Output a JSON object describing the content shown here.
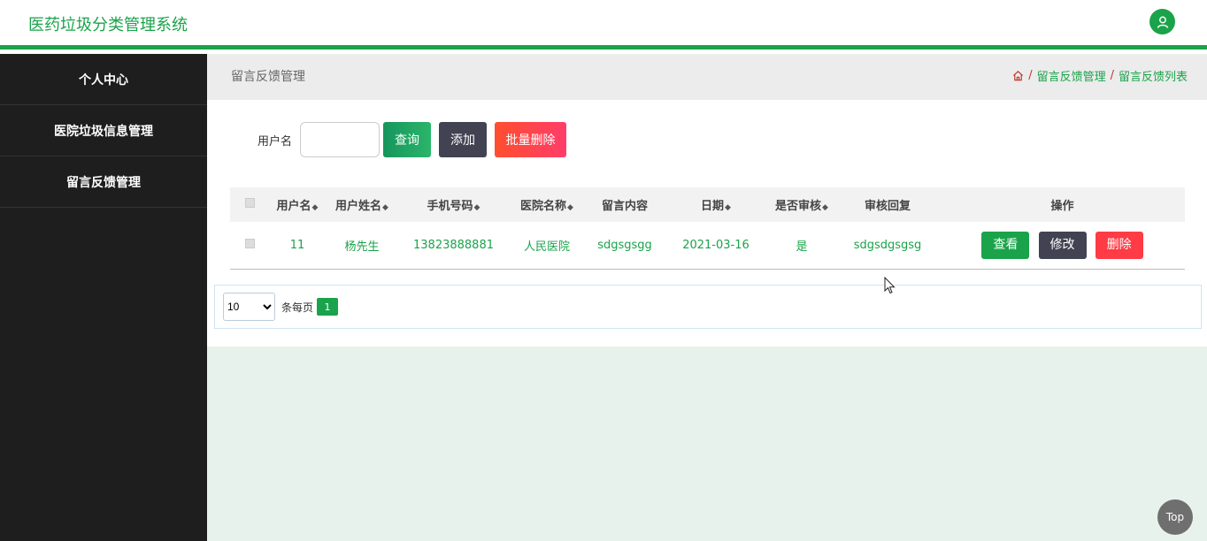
{
  "app": {
    "title": "医药垃圾分类管理系统"
  },
  "sidebar": {
    "items": [
      {
        "label": "个人中心"
      },
      {
        "label": "医院垃圾信息管理"
      },
      {
        "label": "留言反馈管理"
      }
    ]
  },
  "page": {
    "title": "留言反馈管理"
  },
  "breadcrumb": {
    "sep": "/",
    "items": [
      "留言反馈管理",
      "留言反馈列表"
    ]
  },
  "search": {
    "label": "用户名",
    "value": "",
    "query_label": "查询",
    "add_label": "添加",
    "bulk_delete_label": "批量删除"
  },
  "table": {
    "headers": [
      "用户名",
      "用户姓名",
      "手机号码",
      "医院名称",
      "留言内容",
      "日期",
      "是否审核",
      "审核回复",
      "操作"
    ],
    "rows": [
      {
        "username": "11",
        "name": "杨先生",
        "phone": "13823888881",
        "hospital": "人民医院",
        "content": "sdgsgsgg",
        "date": "2021-03-16",
        "reviewed": "是",
        "reply": "sdgsdgsgsg"
      }
    ],
    "actions": {
      "view": "查看",
      "edit": "修改",
      "delete": "删除"
    }
  },
  "pagination": {
    "page_size": "10",
    "per_page_label": "条每页",
    "current_page": "1"
  },
  "top_button": "Top",
  "colors": {
    "accent": "#1aa34a",
    "sidebar_bg": "#1e1e1e",
    "danger": "#ff3b45",
    "dark_button": "#414353"
  }
}
